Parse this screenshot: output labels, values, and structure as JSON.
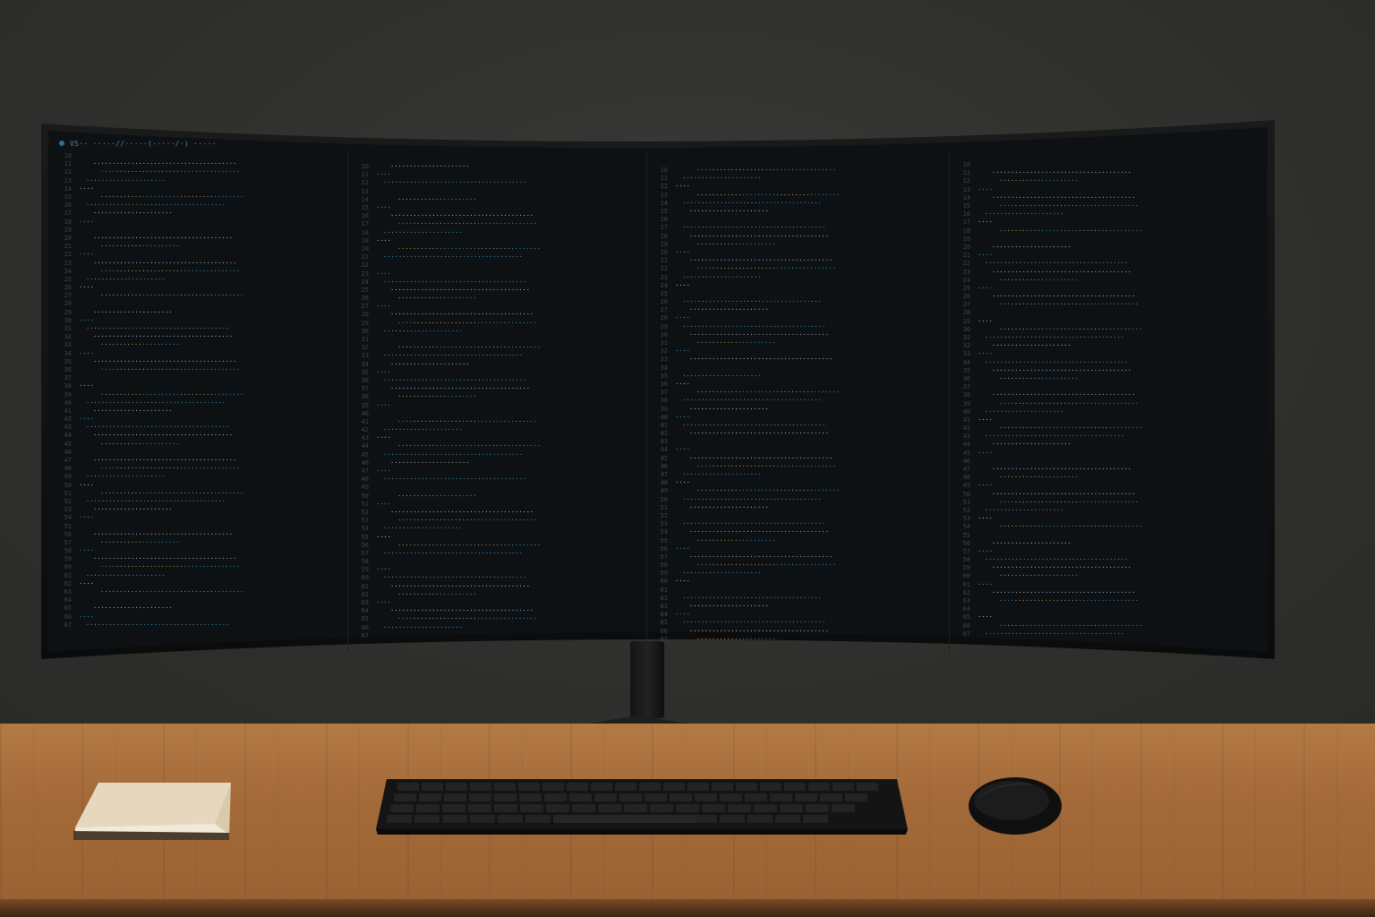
{
  "scene": {
    "description_tags": [
      "curved-ultrawide-monitor",
      "code-editor",
      "wooden-desk",
      "keyboard",
      "mouse",
      "notebook"
    ]
  },
  "editor": {
    "status_text": "VS·· ·····//·····(·····/·) ·····",
    "panes": [
      {
        "lines": [
          {
            "n": "11",
            "t": "·······,·····;"
          },
          {
            "n": "12",
            "t": "······  ·\\·····  ·····,·····, ·)  {"
          },
          {
            "n": "13",
            "t": ""
          },
          {
            "n": "14",
            "t": "·····(·········· ·········:·····)"
          },
          {
            "n": "15",
            "t": "  ·······(···········  ····"
          },
          {
            "n": "16",
            "t": "  ····  ········ ········  (·"
          },
          {
            "n": "17",
            "t": "  ·····  ······  ········;"
          },
          {
            "n": "18",
            "t": ""
          },
          {
            "n": "19",
            "t": "········"
          },
          {
            "n": "20",
            "t": ""
          },
          {
            "n": "21",
            "t": "·····  ···········  ·······:  ·)"
          },
          {
            "n": "22",
            "t": "  ····  ········  ·····"
          },
          {
            "n": "23",
            "t": "  ····  ············.·······;"
          },
          {
            "n": "24",
            "t": "  ····  ·········  ····  ·····;"
          },
          {
            "n": "25",
            "t": "}"
          }
        ]
      }
    ]
  }
}
